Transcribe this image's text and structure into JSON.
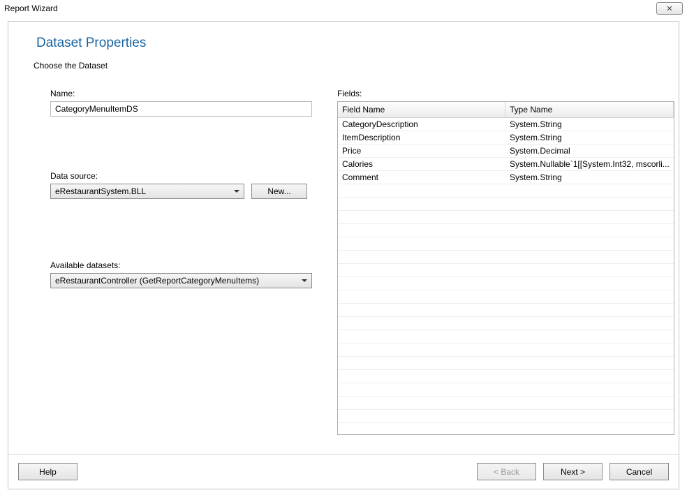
{
  "window": {
    "title": "Report Wizard",
    "close_glyph": "✕"
  },
  "page": {
    "title": "Dataset Properties",
    "subtitle": "Choose the Dataset"
  },
  "left": {
    "name_label": "Name:",
    "name_value": "CategoryMenuItemDS",
    "datasource_label": "Data source:",
    "datasource_value": "eRestaurantSystem.BLL",
    "new_button": "New...",
    "available_label": "Available datasets:",
    "available_value": "eRestaurantController (GetReportCategoryMenuItems)"
  },
  "right": {
    "fields_label": "Fields:",
    "columns": {
      "field_name": "Field Name",
      "type_name": "Type Name"
    },
    "rows": [
      {
        "field": "CategoryDescription",
        "type": "System.String"
      },
      {
        "field": "ItemDescription",
        "type": "System.String"
      },
      {
        "field": "Price",
        "type": "System.Decimal"
      },
      {
        "field": "Calories",
        "type": "System.Nullable`1[[System.Int32, mscorli..."
      },
      {
        "field": "Comment",
        "type": "System.String"
      }
    ],
    "blank_rows": 19
  },
  "footer": {
    "help": "Help",
    "back": "< Back",
    "next": "Next >",
    "cancel": "Cancel"
  }
}
